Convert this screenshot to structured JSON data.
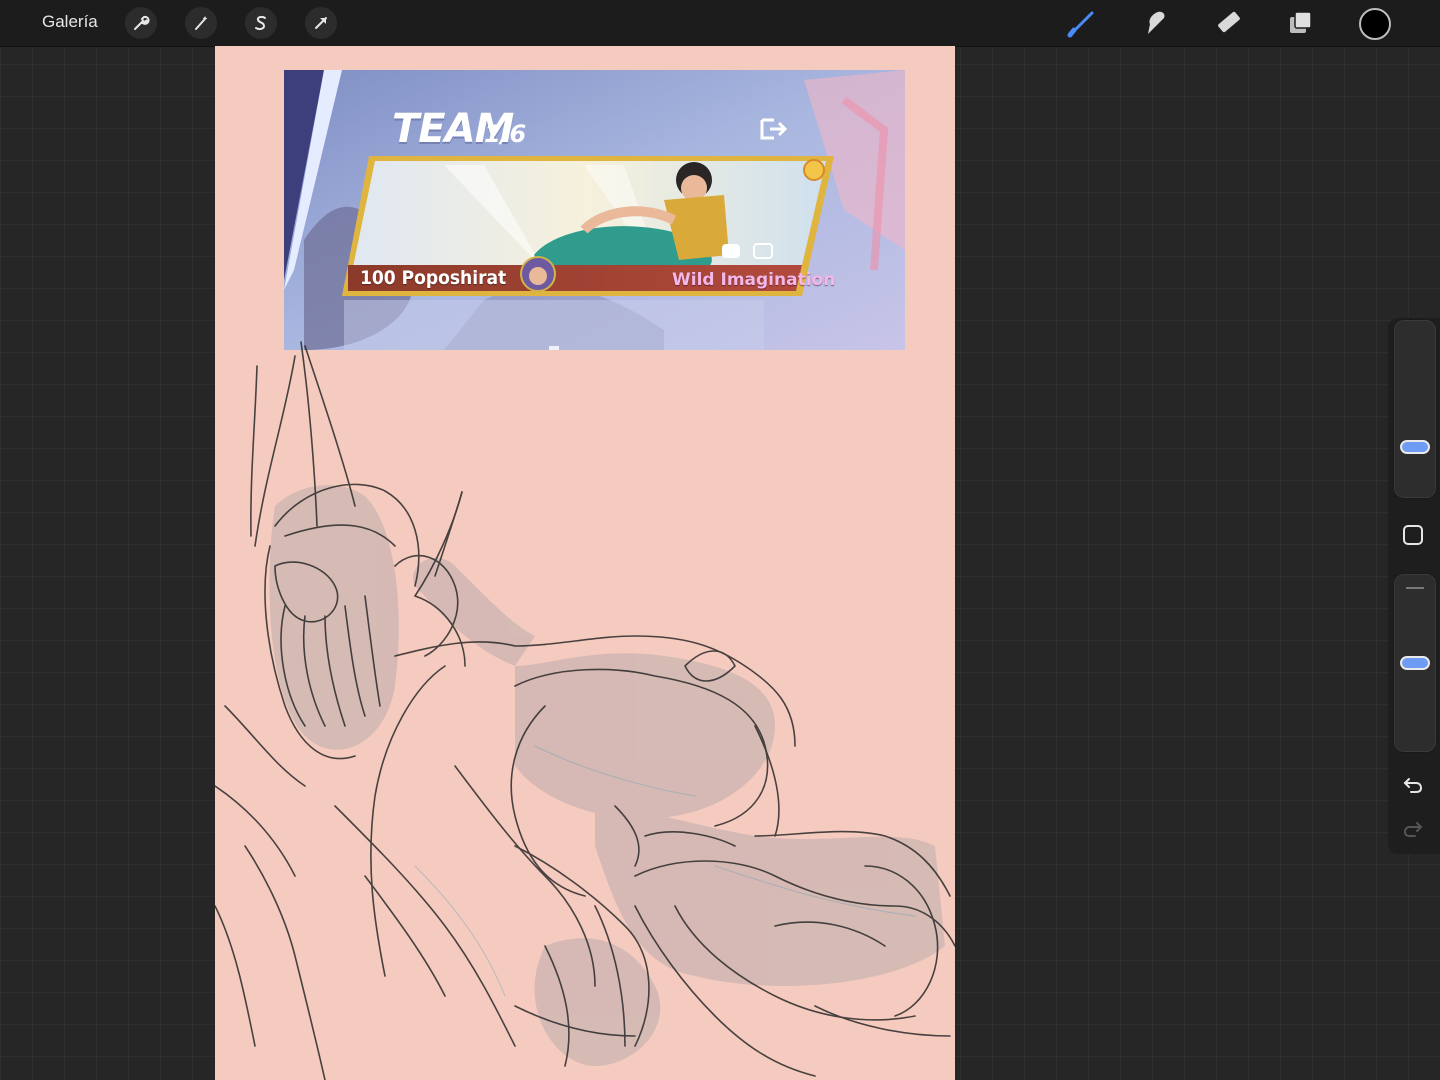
{
  "topbar": {
    "gallery_label": "Galería",
    "left_tools": [
      "wrench-icon",
      "magic-wand-icon",
      "selection-s-icon",
      "arrow-transform-icon"
    ],
    "right_tools": [
      "brush-icon",
      "smudge-icon",
      "eraser-icon",
      "layers-icon"
    ],
    "current_color": "#000000",
    "accent_color": "#4a8cf7"
  },
  "reference": {
    "team_label": "TEAM",
    "team_count": "1/6",
    "player_name": "100 Poposhirat",
    "player_title": "Wild Imagination"
  },
  "sidebar": {
    "brush_size_level": 0.25,
    "opacity_level": 0.5,
    "buttons": [
      "modify-square-icon",
      "undo-icon",
      "redo-icon"
    ]
  }
}
